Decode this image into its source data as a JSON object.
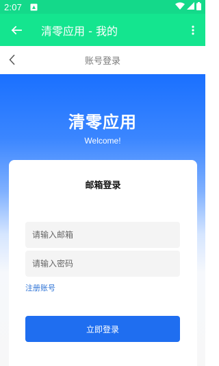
{
  "status_bar": {
    "time": "2:07",
    "icons": [
      "notification-icon",
      "wifi-icon",
      "signal-icon",
      "battery-icon"
    ]
  },
  "app_bar": {
    "title": "清零应用 - 我的",
    "back_icon": "arrow-left-icon",
    "more_icon": "more-vert-icon",
    "color": "#14e58f"
  },
  "page_header": {
    "title": "账号登录",
    "back_icon": "chevron-left-icon"
  },
  "hero": {
    "brand": "清零应用",
    "welcome": "Welcome!",
    "gradient_top": "#1a70ff"
  },
  "login_card": {
    "title": "邮箱登录",
    "email_placeholder": "请输入邮箱",
    "password_placeholder": "请输入密码",
    "register_link": "注册账号",
    "login_button": "立即登录",
    "button_color": "#1f6ef0"
  }
}
